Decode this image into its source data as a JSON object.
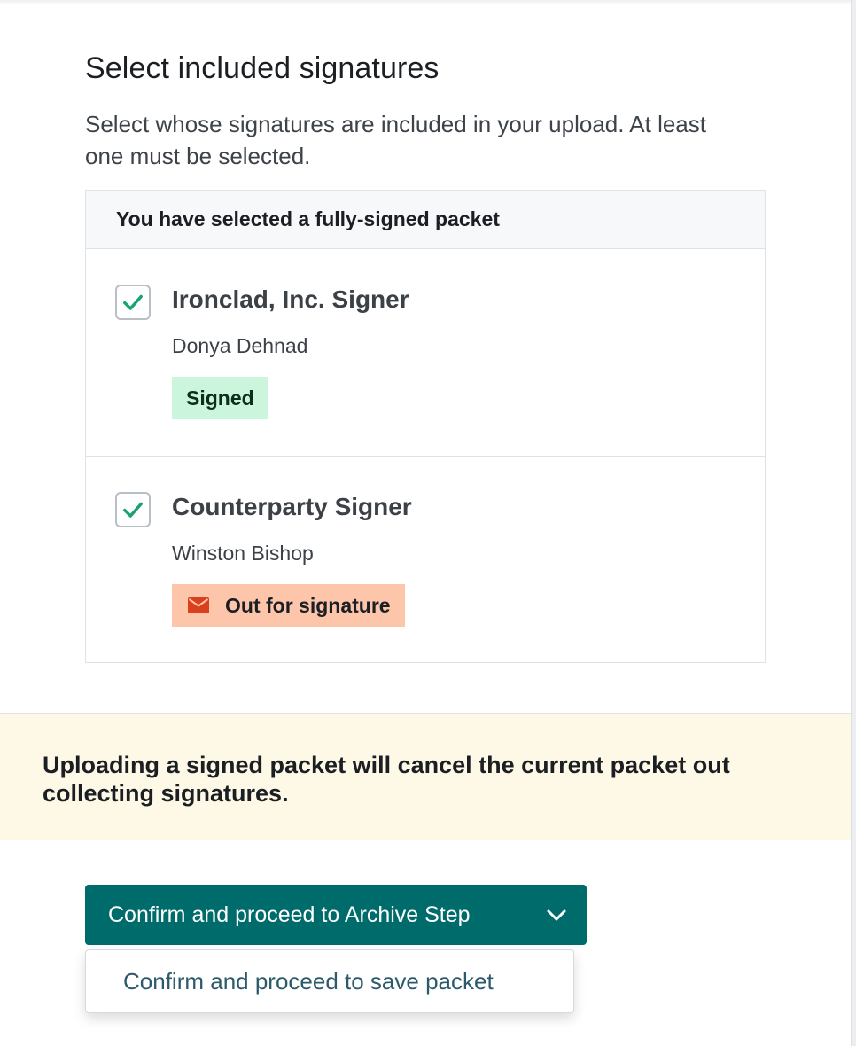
{
  "title": "Select included signatures",
  "description": "Select whose signatures are included in your upload. At least one must be selected.",
  "panel": {
    "header": "You have selected a fully-signed packet",
    "signers": [
      {
        "role": "Ironclad, Inc. Signer",
        "name": "Donya Dehnad",
        "status": "Signed",
        "checked": true
      },
      {
        "role": "Counterparty Signer",
        "name": "Winston Bishop",
        "status": "Out for signature",
        "status_icon": "mail-icon",
        "checked": true
      }
    ]
  },
  "warning": "Uploading a signed packet will cancel the current packet out collecting signatures.",
  "actions": {
    "primary_label": "Confirm and proceed to Archive Step",
    "dropdown_items": [
      "Confirm and proceed to save packet"
    ]
  },
  "colors": {
    "primary": "#006b6b",
    "check": "#1aa36f",
    "signed_badge": "#ccf5dd",
    "out_badge": "#fdc6ab",
    "mail_icon": "#d9401e",
    "warning_bg": "#fef9e7"
  }
}
